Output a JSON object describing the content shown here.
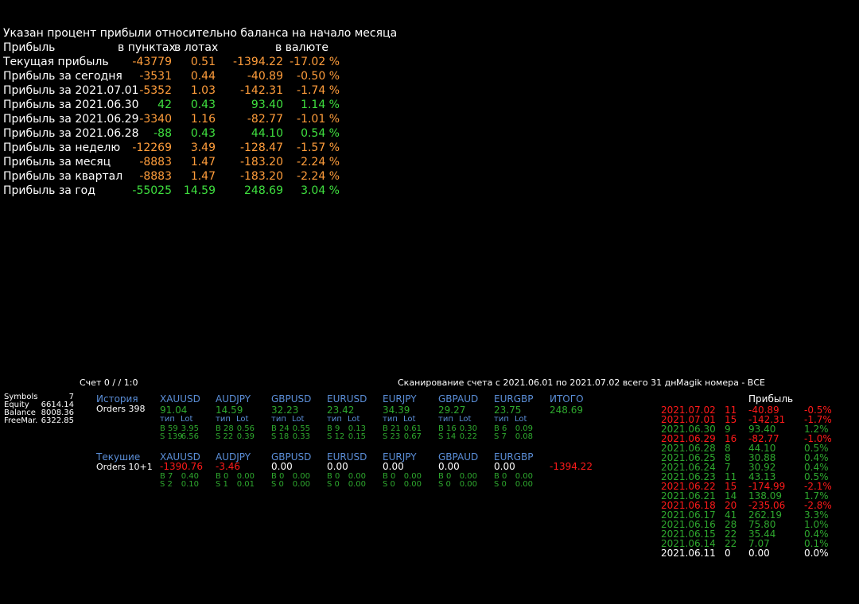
{
  "colors": {
    "background": "#000000",
    "orange": "#ff9d3b",
    "green": "#3fe03f",
    "dark_green": "#2ea82e",
    "red": "#ff1a1a",
    "blue": "#5a8dd6",
    "white": "#ffffff"
  },
  "profit_panel": {
    "title": "Указан процент прибыли относительно баланса на начало месяца",
    "header": {
      "label": "Прибыль",
      "points": "в пунктах",
      "lots": "в лотах",
      "currency": "в валюте"
    },
    "rows": [
      {
        "label": "Текущая прибыль",
        "points": "-43779",
        "lots": "0.51",
        "currency": "-1394.22",
        "percent": "-17.02 %",
        "color": "orange"
      },
      {
        "label": "Прибыль за сегодня",
        "points": "-3531",
        "lots": "0.44",
        "currency": "-40.89",
        "percent": "-0.50 %",
        "color": "orange"
      },
      {
        "label": "Прибыль за 2021.07.01",
        "points": "-5352",
        "lots": "1.03",
        "currency": "-142.31",
        "percent": "-1.74 %",
        "color": "orange"
      },
      {
        "label": "Прибыль за 2021.06.30",
        "points": "42",
        "lots": "0.43",
        "currency": "93.40",
        "percent": "1.14 %",
        "color": "green"
      },
      {
        "label": "Прибыль за 2021.06.29",
        "points": "-3340",
        "lots": "1.16",
        "currency": "-82.77",
        "percent": "-1.01 %",
        "color": "orange"
      },
      {
        "label": "Прибыль за 2021.06.28",
        "points": "-88",
        "lots": "0.43",
        "currency": "44.10",
        "percent": "0.54 %",
        "color": "green"
      },
      {
        "label": "Прибыль за неделю",
        "points": "-12269",
        "lots": "3.49",
        "currency": "-128.47",
        "percent": "-1.57 %",
        "color": "orange"
      },
      {
        "label": "Прибыль за месяц",
        "points": "-8883",
        "lots": "1.47",
        "currency": "-183.20",
        "percent": "-2.24 %",
        "color": "orange"
      },
      {
        "label": "Прибыль за квартал",
        "points": "-8883",
        "lots": "1.47",
        "currency": "-183.20",
        "percent": "-2.24 %",
        "color": "orange"
      },
      {
        "label": "Прибыль за год",
        "points": "-55025",
        "lots": "14.59",
        "currency": "248.69",
        "percent": "3.04 %",
        "color": "green"
      }
    ]
  },
  "scan_bar": {
    "account": "Счет 0 /  / 1:0",
    "scan_text": "Сканирование счета с 2021.06.01 по 2021.07.02 всего 31 дн.",
    "magic": "Magik номера - ВСЕ"
  },
  "account_info": [
    {
      "label": "Symbols",
      "value": "7"
    },
    {
      "label": "Equity",
      "value": "6614.14"
    },
    {
      "label": "Balance",
      "value": "8008.36"
    },
    {
      "label": "FreeMar.",
      "value": "6322.85"
    }
  ],
  "history": {
    "title": "История",
    "orders": "Orders 398",
    "type_label": "тип",
    "lot_label": "Lot",
    "symbols": [
      {
        "name": "XAUUSD",
        "value": "91.04",
        "b": "B 59",
        "b_lot": "3.95",
        "s": "S 139",
        "s_lot": "6.56"
      },
      {
        "name": "AUDJPY",
        "value": "14.59",
        "b": "B 28",
        "b_lot": "0.56",
        "s": "S 22",
        "s_lot": "0.39"
      },
      {
        "name": "GBPUSD",
        "value": "32.23",
        "b": "B 24",
        "b_lot": "0.55",
        "s": "S 18",
        "s_lot": "0.33"
      },
      {
        "name": "EURUSD",
        "value": "23.42",
        "b": "B 9",
        "b_lot": "0.13",
        "s": "S 12",
        "s_lot": "0.15"
      },
      {
        "name": "EURJPY",
        "value": "34.39",
        "b": "B 21",
        "b_lot": "0.61",
        "s": "S 23",
        "s_lot": "0.67"
      },
      {
        "name": "GBPAUD",
        "value": "29.27",
        "b": "B 16",
        "b_lot": "0.30",
        "s": "S 14",
        "s_lot": "0.22"
      },
      {
        "name": "EURGBP",
        "value": "23.75",
        "b": "B 6",
        "b_lot": "0.09",
        "s": "S 7",
        "s_lot": "0.08"
      }
    ],
    "total_label": "ИТОГО",
    "total_value": "248.69"
  },
  "current": {
    "title": "Текушие",
    "orders": "Orders 10+1",
    "symbols": [
      {
        "name": "XAUUSD",
        "value": "-1390.76",
        "vcolor": "red",
        "b": "B 7",
        "b_lot": "0.40",
        "s": "S 2",
        "s_lot": "0.10"
      },
      {
        "name": "AUDJPY",
        "value": "-3.46",
        "vcolor": "red",
        "b": "B 0",
        "b_lot": "0.00",
        "s": "S 1",
        "s_lot": "0.01"
      },
      {
        "name": "GBPUSD",
        "value": "0.00",
        "vcolor": "white",
        "b": "B 0",
        "b_lot": "0.00",
        "s": "S 0",
        "s_lot": "0.00"
      },
      {
        "name": "EURUSD",
        "value": "0.00",
        "vcolor": "white",
        "b": "B 0",
        "b_lot": "0.00",
        "s": "S 0",
        "s_lot": "0.00"
      },
      {
        "name": "EURJPY",
        "value": "0.00",
        "vcolor": "white",
        "b": "B 0",
        "b_lot": "0.00",
        "s": "S 0",
        "s_lot": "0.00"
      },
      {
        "name": "GBPAUD",
        "value": "0.00",
        "vcolor": "white",
        "b": "B 0",
        "b_lot": "0.00",
        "s": "S 0",
        "s_lot": "0.00"
      },
      {
        "name": "EURGBP",
        "value": "0.00",
        "vcolor": "white",
        "b": "B 0",
        "b_lot": "0.00",
        "s": "S 0",
        "s_lot": "0.00"
      }
    ],
    "total_value": "-1394.22"
  },
  "daily": {
    "header": "Прибыль",
    "rows": [
      {
        "date": "2021.07.02",
        "count": "11",
        "profit": "-40.89",
        "percent": "-0.5%",
        "color": "red"
      },
      {
        "date": "2021.07.01",
        "count": "15",
        "profit": "-142.31",
        "percent": "-1.7%",
        "color": "red"
      },
      {
        "date": "2021.06.30",
        "count": "9",
        "profit": "93.40",
        "percent": "1.2%",
        "color": "green"
      },
      {
        "date": "2021.06.29",
        "count": "16",
        "profit": "-82.77",
        "percent": "-1.0%",
        "color": "red"
      },
      {
        "date": "2021.06.28",
        "count": "8",
        "profit": "44.10",
        "percent": "0.5%",
        "color": "green"
      },
      {
        "date": "2021.06.25",
        "count": "8",
        "profit": "30.88",
        "percent": "0.4%",
        "color": "green"
      },
      {
        "date": "2021.06.24",
        "count": "7",
        "profit": "30.92",
        "percent": "0.4%",
        "color": "green"
      },
      {
        "date": "2021.06.23",
        "count": "11",
        "profit": "43.13",
        "percent": "0.5%",
        "color": "green"
      },
      {
        "date": "2021.06.22",
        "count": "15",
        "profit": "-174.99",
        "percent": "-2.1%",
        "color": "red"
      },
      {
        "date": "2021.06.21",
        "count": "14",
        "profit": "138.09",
        "percent": "1.7%",
        "color": "green"
      },
      {
        "date": "2021.06.18",
        "count": "20",
        "profit": "-235.06",
        "percent": "-2.8%",
        "color": "red"
      },
      {
        "date": "2021.06.17",
        "count": "41",
        "profit": "262.19",
        "percent": "3.3%",
        "color": "green"
      },
      {
        "date": "2021.06.16",
        "count": "28",
        "profit": "75.80",
        "percent": "1.0%",
        "color": "green"
      },
      {
        "date": "2021.06.15",
        "count": "22",
        "profit": "35.44",
        "percent": "0.4%",
        "color": "green"
      },
      {
        "date": "2021.06.14",
        "count": "22",
        "profit": "7.07",
        "percent": "0.1%",
        "color": "green"
      },
      {
        "date": "2021.06.11",
        "count": "0",
        "profit": "0.00",
        "percent": "0.0%",
        "color": "white"
      }
    ]
  }
}
